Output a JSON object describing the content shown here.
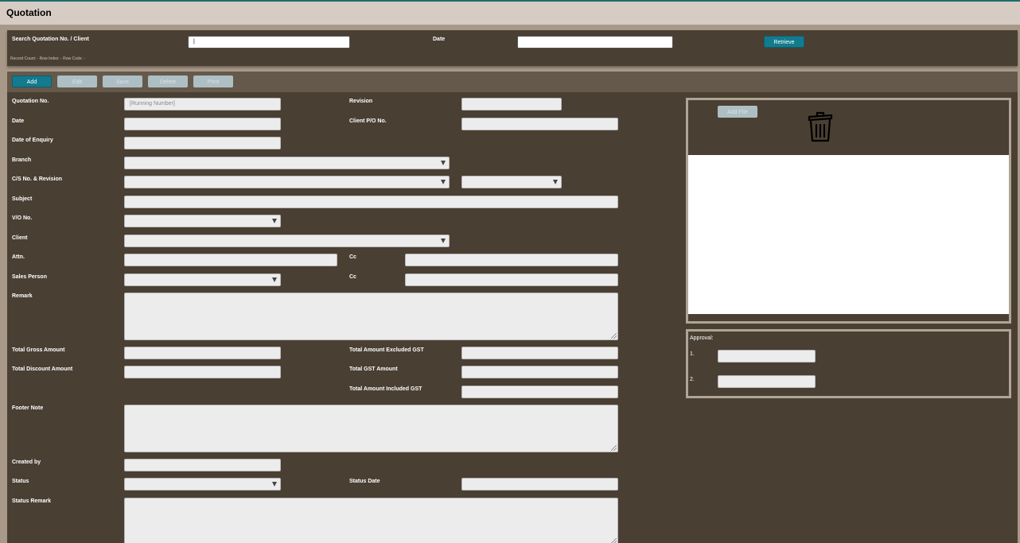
{
  "title": "Quotation",
  "search": {
    "label": "Search Quotation No. / Client",
    "value": "|",
    "date_label": "Date",
    "date_value": "",
    "retrieve_label": "Retrieve",
    "record_info": "Record Count: - Row Index: - Row Code: -"
  },
  "toolbar": {
    "add": "Add",
    "edit": "Edit",
    "save": "Save",
    "delete": "Delete",
    "print": "Print"
  },
  "form": {
    "quotation_no": {
      "label": "Quotation No.",
      "placeholder": "[Running Number]"
    },
    "revision": {
      "label": "Revision"
    },
    "date": {
      "label": "Date"
    },
    "client_po": {
      "label": "Client P/O No."
    },
    "date_of_enquiry": {
      "label": "Date of Enquiry"
    },
    "branch": {
      "label": "Branch"
    },
    "cs_no": {
      "label": "C/S No. & Revision"
    },
    "subject": {
      "label": "Subject"
    },
    "vo_no": {
      "label": "V/O No."
    },
    "client": {
      "label": "Client"
    },
    "attn": {
      "label": "Attn."
    },
    "cc1": {
      "label": "Cc"
    },
    "sales_person": {
      "label": "Sales Person"
    },
    "cc2": {
      "label": "Cc"
    },
    "remark": {
      "label": "Remark"
    },
    "total_gross": {
      "label": "Total Gross Amount"
    },
    "total_excl_gst": {
      "label": "Total Amount Excluded GST"
    },
    "total_discount": {
      "label": "Total Discount Amount"
    },
    "total_gst": {
      "label": "Total GST Amount"
    },
    "total_incl_gst": {
      "label": "Total Amount Included GST"
    },
    "footer_note": {
      "label": "Footer Note"
    },
    "created_by": {
      "label": "Created by"
    },
    "status": {
      "label": "Status"
    },
    "status_date": {
      "label": "Status Date"
    },
    "status_remark": {
      "label": "Status Remark"
    }
  },
  "attachment": {
    "add_file": "Add File",
    "trash_icon": "trash-icon"
  },
  "approval": {
    "label": "Approval:",
    "row1": "1.",
    "row2": "2."
  },
  "colors": {
    "panel": "#4a3f33",
    "toolbar": "#65594c",
    "primary": "#137b8e",
    "disabled": "#aebfc4"
  }
}
